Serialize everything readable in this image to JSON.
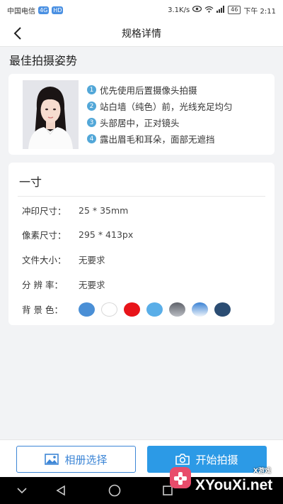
{
  "status_bar": {
    "carrier": "中国电信",
    "signal_badge": "4G",
    "wifi_badge": "HD",
    "speed": "3.1K/s",
    "battery": "46",
    "time": "下午 2:11"
  },
  "header": {
    "title": "规格详情",
    "back_icon": "chevron-left-icon"
  },
  "tips_section": {
    "title": "最佳拍摄姿势",
    "items": [
      {
        "num": "1",
        "text": "优先使用后置摄像头拍摄"
      },
      {
        "num": "2",
        "text": "站白墙（纯色）前，光线充足均匀"
      },
      {
        "num": "3",
        "text": "头部居中，正对镜头"
      },
      {
        "num": "4",
        "text": "露出眉毛和耳朵，面部无遮挡"
      }
    ]
  },
  "spec": {
    "name": "一寸",
    "rows": [
      {
        "label": "冲印尺寸：",
        "value": "25 * 35mm"
      },
      {
        "label": "像素尺寸：",
        "value": "295 * 413px"
      },
      {
        "label": "文件大小：",
        "value": "无要求"
      },
      {
        "label": "分 辨 率：",
        "value": "无要求"
      }
    ],
    "bg_label": "背 景 色：",
    "bg_colors": [
      "#4a8fd6",
      "#ffffff",
      "#e8141a",
      "#5aaee8",
      "#7a7d85",
      "#4a8fd6-gradient",
      "#2b4d73"
    ]
  },
  "actions": {
    "album_label": "相册选择",
    "shoot_label": "开始拍摄",
    "album_icon": "image-icon",
    "shoot_icon": "camera-icon"
  },
  "watermark": {
    "text": "XYouXi.net",
    "sub": "X游戏"
  },
  "colors": {
    "accent": "#2c9ae6",
    "outline": "#3d86d6",
    "tip_badge": "#52a7d8"
  }
}
